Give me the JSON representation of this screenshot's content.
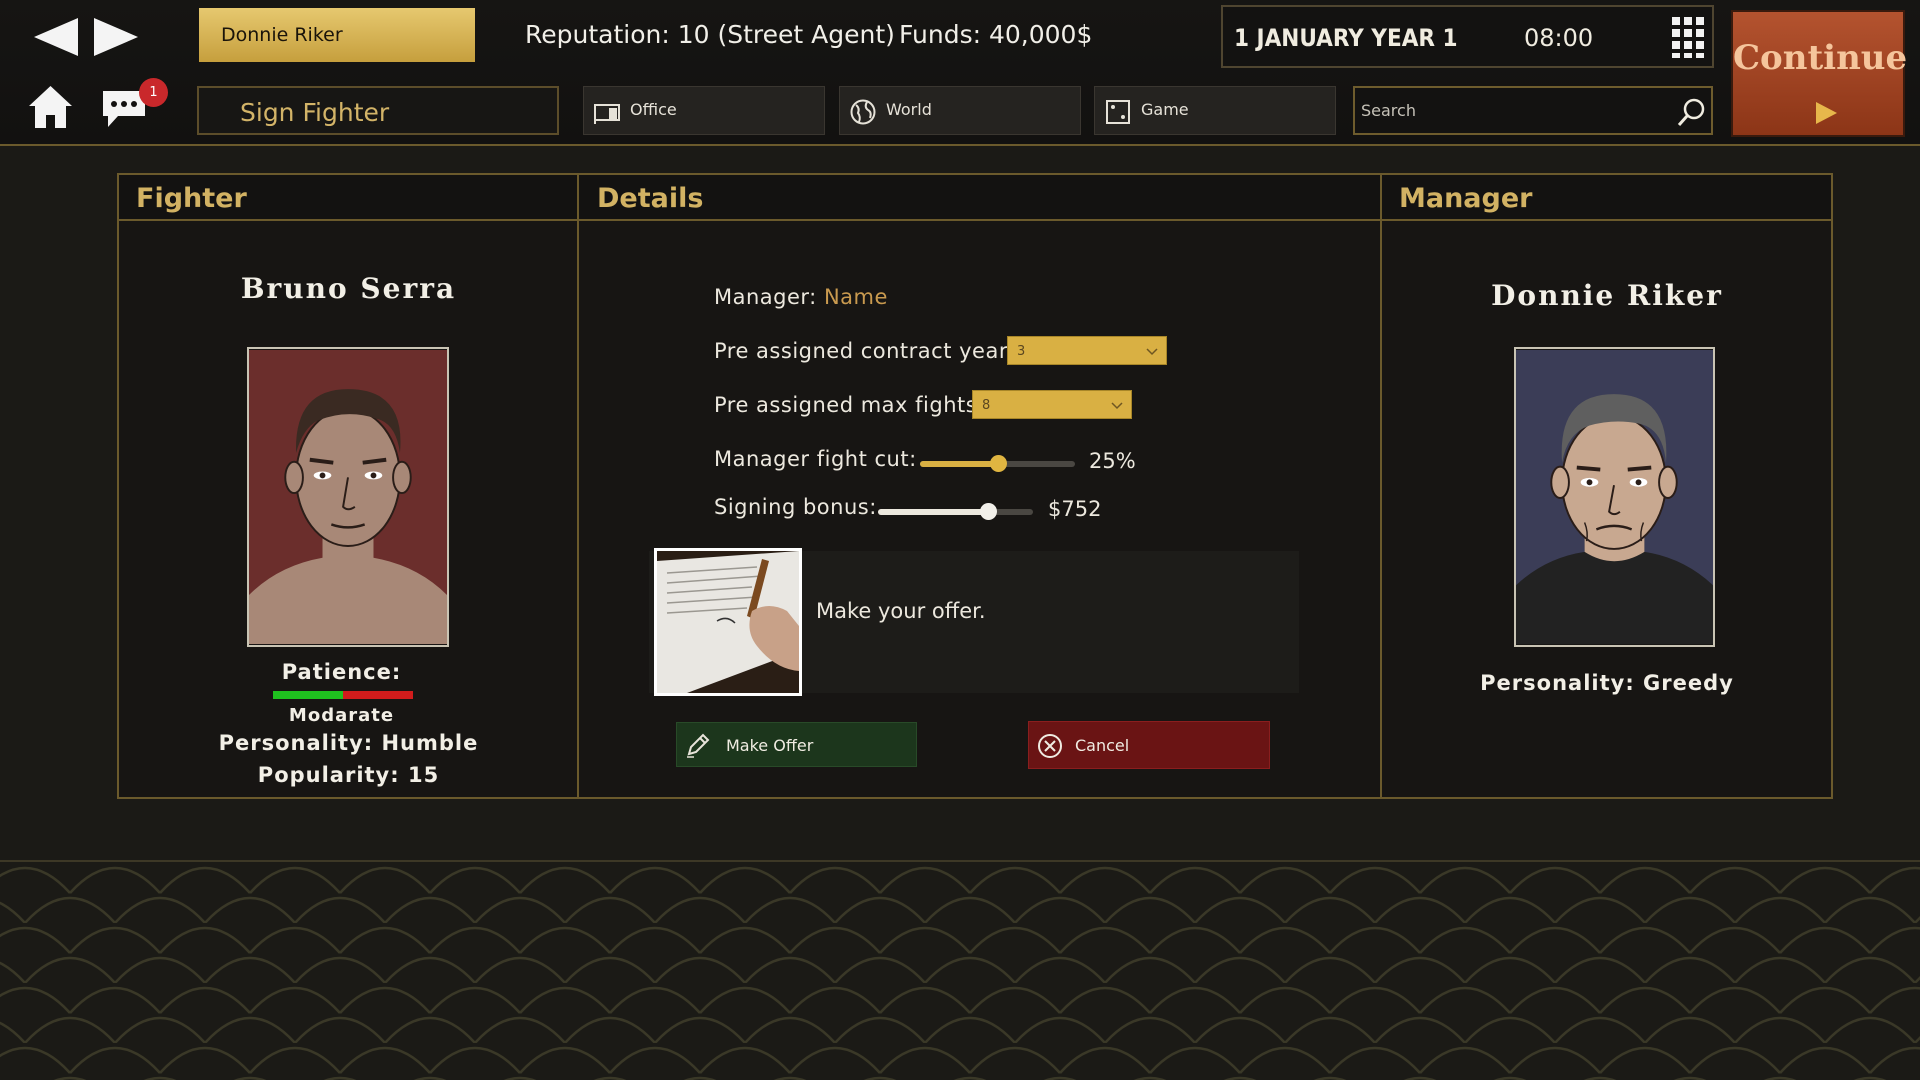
{
  "topbar": {
    "agent_name": "Donnie Riker",
    "reputation": "Reputation: 10 (Street Agent)",
    "funds": "Funds: 40,000$",
    "date": "1 JANUARY YEAR 1",
    "time": "08:00",
    "continue_label": "Continue",
    "page_title": "Sign Fighter",
    "chat_badge_count": "1",
    "menu": {
      "office": "Office",
      "world": "World",
      "game": "Game"
    },
    "search_placeholder": "Search"
  },
  "columns": {
    "fighter": "Fighter",
    "details": "Details",
    "manager": "Manager"
  },
  "fighter": {
    "name": "Bruno Serra",
    "patience_label": "Patience:",
    "patience_level": 0.5,
    "patience_value": "Modarate",
    "personality": "Personality: Humble",
    "popularity": "Popularity: 15"
  },
  "details": {
    "manager_label": "Manager:",
    "manager_name": "Name",
    "contract_years_label": "Pre assigned contract years:",
    "contract_years_value": "3",
    "max_fights_label": "Pre assigned max fights:",
    "max_fights_value": "8",
    "fight_cut_label": "Manager fight cut:",
    "fight_cut_value": "25%",
    "fight_cut_level": 0.5,
    "signing_bonus_label": "Signing bonus:",
    "signing_bonus_value": "$752",
    "signing_bonus_level": 0.71,
    "offer_prompt": "Make your offer.",
    "make_offer_label": "Make Offer",
    "cancel_label": "Cancel"
  },
  "manager": {
    "name": "Donnie Riker",
    "personality": "Personality: Greedy"
  },
  "colors": {
    "gold_accent": "#d2b263",
    "select_gold": "#d9b043",
    "continue_orange": "#a7481f",
    "make_offer_green": "#1c361c",
    "cancel_red": "#6a1414",
    "patience_green": "#1fc21f",
    "patience_red": "#d11c1c"
  }
}
